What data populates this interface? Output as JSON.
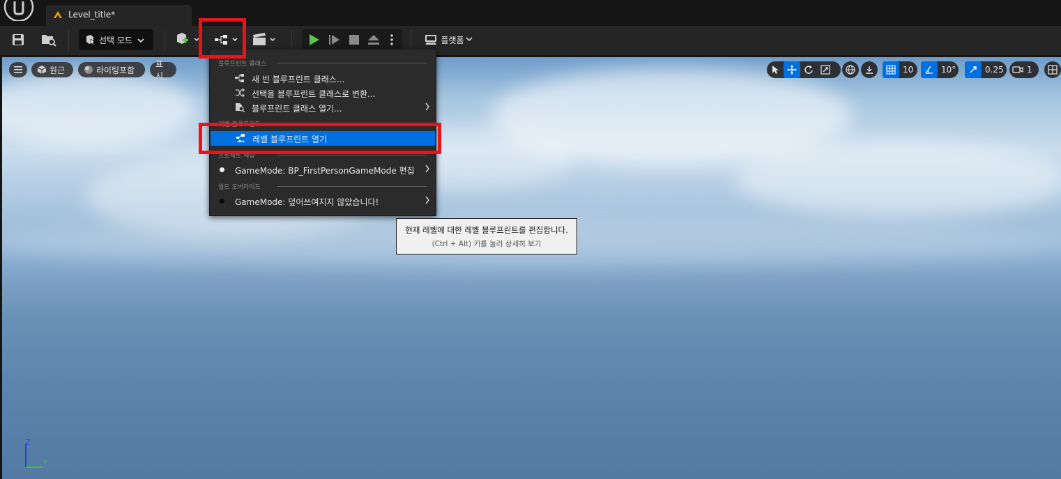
{
  "tab": {
    "title": "Level_title*"
  },
  "toolbar": {
    "mode_label": "선택 모드",
    "platform_label": "플랫폼"
  },
  "viewport": {
    "perspective_label": "원근",
    "lighting_label": "라이팅포함",
    "show_label": "표시",
    "grid_value": "10",
    "angle_value": "10°",
    "scale_value": "0.25",
    "camera_value": "1",
    "axis_z": "Z",
    "axis_y": "Y"
  },
  "menu": {
    "section_blueprint_class": "블루프린트 클래스",
    "items_class": [
      {
        "label": "새 빈 블루프린트 클래스...",
        "icon": "blueprint-new-icon"
      },
      {
        "label": "선택을 블루프린트 클래스로 변환...",
        "icon": "convert-icon"
      },
      {
        "label": "블루프린트 클래스 열기...",
        "icon": "blueprint-open-icon",
        "submenu": true
      }
    ],
    "section_level_blueprint": "레벨 블루프린트",
    "open_level_blueprint": "레벨 블루프린트 열기",
    "section_project_settings": "프로젝트 세팅",
    "gamemode_edit": "GameMode: BP_FirstPersonGameMode 편집",
    "section_world_override": "월드 오버라이드",
    "gamemode_override": "GameMode: 덮어쓰여지지 않았습니다!"
  },
  "tooltip": {
    "line1": "현재 레벨에 대한 레벨 블루프린트를 편집합니다.",
    "line2": "(Ctrl + Alt) 키를 눌러 상세히 보기"
  },
  "colors": {
    "accent": "#0070e0",
    "highlight_box": "#e8141b",
    "play_green": "#5cc24a"
  }
}
